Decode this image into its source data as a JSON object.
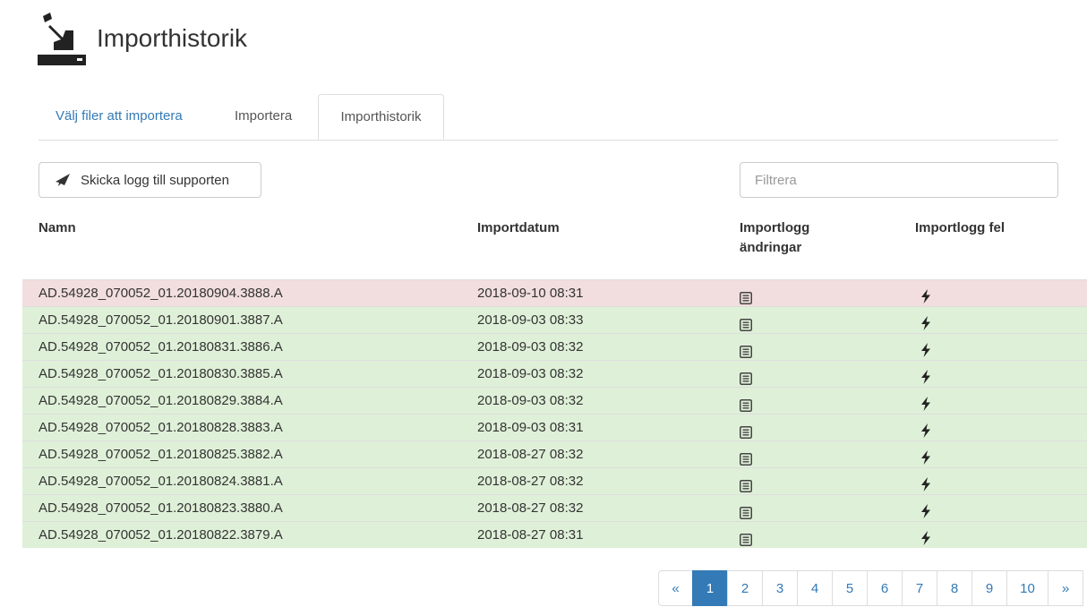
{
  "header": {
    "title": "Importhistorik",
    "icon": "import-arrow-icon"
  },
  "tabs": [
    {
      "label": "Välj filer att importera",
      "active": false
    },
    {
      "label": "Importera",
      "active": false
    },
    {
      "label": "Importhistorik",
      "active": true
    }
  ],
  "toolbar": {
    "send_log_label": "Skicka logg till supporten",
    "send_icon": "paper-plane-icon"
  },
  "filter": {
    "placeholder": "Filtrera",
    "value": ""
  },
  "table": {
    "columns": {
      "name": "Namn",
      "date": "Importdatum",
      "log_changes": "Importlogg ändringar",
      "log_errors": "Importlogg fel"
    },
    "rows": [
      {
        "name": "AD.54928_070052_01.20180904.3888.A",
        "date": "2018-09-10 08:31",
        "status": "error"
      },
      {
        "name": "AD.54928_070052_01.20180901.3887.A",
        "date": "2018-09-03 08:33",
        "status": "ok"
      },
      {
        "name": "AD.54928_070052_01.20180831.3886.A",
        "date": "2018-09-03 08:32",
        "status": "ok"
      },
      {
        "name": "AD.54928_070052_01.20180830.3885.A",
        "date": "2018-09-03 08:32",
        "status": "ok"
      },
      {
        "name": "AD.54928_070052_01.20180829.3884.A",
        "date": "2018-09-03 08:32",
        "status": "ok"
      },
      {
        "name": "AD.54928_070052_01.20180828.3883.A",
        "date": "2018-09-03 08:31",
        "status": "ok"
      },
      {
        "name": "AD.54928_070052_01.20180825.3882.A",
        "date": "2018-08-27 08:32",
        "status": "ok"
      },
      {
        "name": "AD.54928_070052_01.20180824.3881.A",
        "date": "2018-08-27 08:32",
        "status": "ok"
      },
      {
        "name": "AD.54928_070052_01.20180823.3880.A",
        "date": "2018-08-27 08:32",
        "status": "ok"
      },
      {
        "name": "AD.54928_070052_01.20180822.3879.A",
        "date": "2018-08-27 08:31",
        "status": "ok"
      }
    ],
    "log_icon": "list-document-icon",
    "error_icon": "lightning-bolt-icon"
  },
  "pagination": {
    "prev": "«",
    "pages": [
      "1",
      "2",
      "3",
      "4",
      "5",
      "6",
      "7",
      "8",
      "9",
      "10"
    ],
    "active": "1",
    "next": "»"
  },
  "colors": {
    "link": "#337ab7",
    "row_error": "#f2dede",
    "row_ok": "#dff0d8",
    "active_page": "#337ab7"
  }
}
